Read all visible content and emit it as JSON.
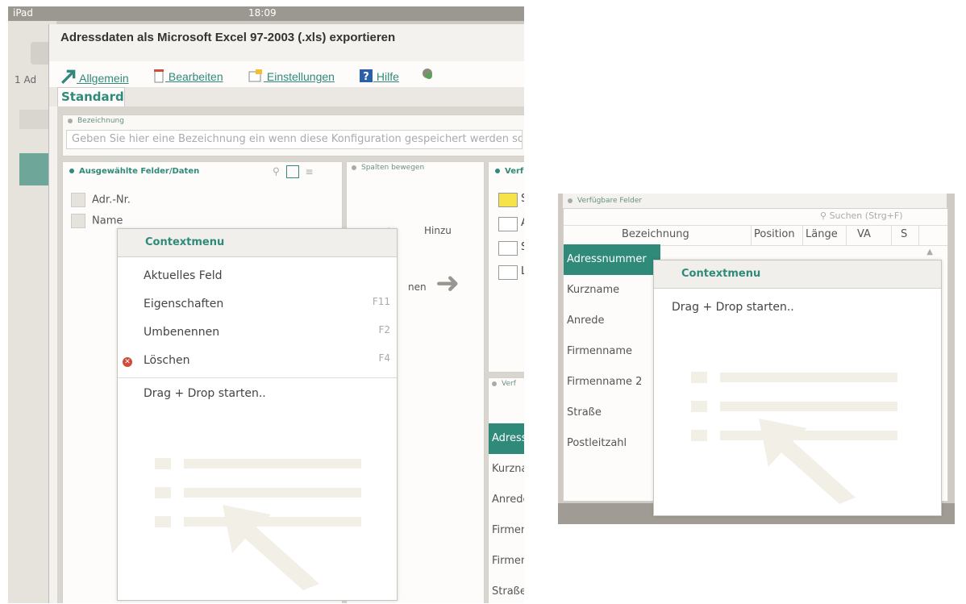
{
  "status": {
    "carrier": "iPad",
    "time": "18:09"
  },
  "background_app": {
    "tab_label": "1 Ad"
  },
  "dialog": {
    "title": "Adressdaten als Microsoft Excel 97-2003 (.xls) exportieren",
    "menu": [
      {
        "label": "Allgemein",
        "icon": "arrow-up-right-icon"
      },
      {
        "label": "Bearbeiten",
        "icon": "edit-icon"
      },
      {
        "label": "Einstellungen",
        "icon": "settings-icon"
      },
      {
        "label": "Hilfe",
        "icon": "help-icon"
      }
    ],
    "tab": "Standard",
    "bezeichnung": {
      "label": "Bezeichnung",
      "placeholder": "Geben Sie hier eine Bezeichnung ein wenn diese Konfiguration gespeichert werden soll"
    },
    "selected_fields": {
      "header": "Ausgewählte Felder/Daten",
      "items": [
        "Adr.-Nr.",
        "Name"
      ]
    },
    "move_columns": {
      "header": "Spalten bewegen",
      "add": "Hinzu",
      "remove": "nen"
    },
    "available": {
      "header": "Verf",
      "folders": [
        "S",
        "A",
        "S",
        "L"
      ],
      "header2": "Verf",
      "list": [
        "Adress",
        "Kurzna",
        "Anrede",
        "Firmen",
        "Firmen",
        "Straße"
      ]
    }
  },
  "context_menu_1": {
    "title": "Contextmenu",
    "items": [
      {
        "label": "Aktuelles Feld",
        "key": ""
      },
      {
        "label": "Eigenschaften",
        "key": "F11"
      },
      {
        "label": "Umbenennen",
        "key": "F2"
      },
      {
        "label": "Löschen",
        "key": "F4"
      }
    ],
    "drag_label": "Drag + Drop starten.."
  },
  "screenshot2": {
    "header": "Verfügbare Felder",
    "search": "Suchen (Strg+F)",
    "columns": [
      "Bezeichnung",
      "Position",
      "Länge",
      "VA",
      "S"
    ],
    "rows": [
      "Adressnummer",
      "Kurzname",
      "Anrede",
      "Firmenname",
      "Firmenname 2",
      "Straße",
      "Postleitzahl"
    ],
    "context_title": "Contextmenu",
    "context_drag": "Drag + Drop starten.."
  },
  "colors": {
    "accent": "#2f8a7a",
    "delete": "#d14b3b",
    "folder_highlight": "#f6e34a"
  }
}
